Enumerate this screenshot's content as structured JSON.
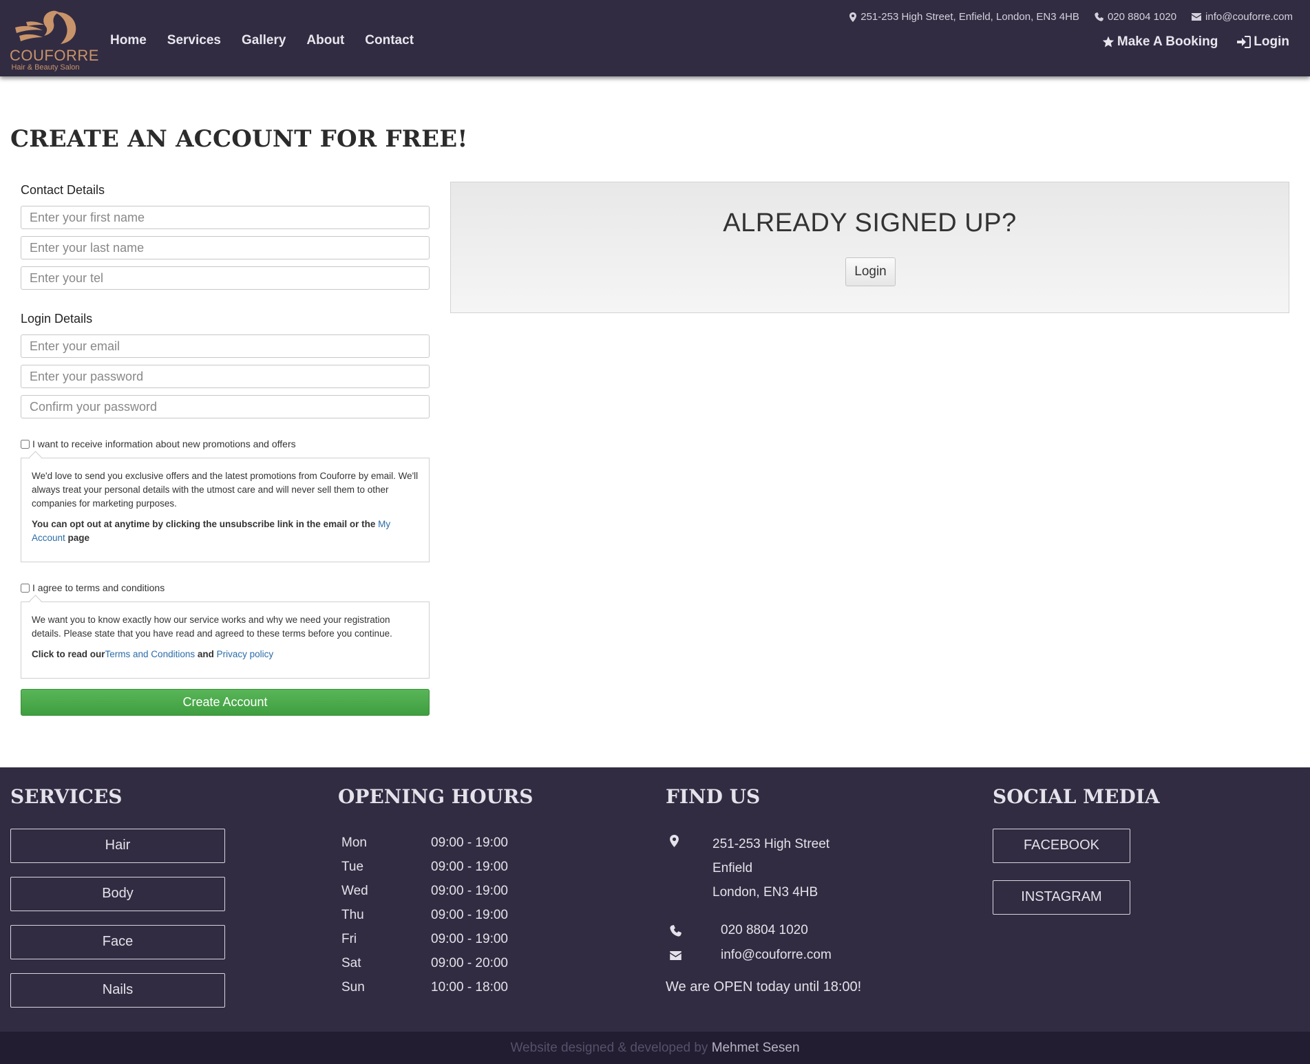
{
  "brand": {
    "name": "COUFORRE",
    "tagline": "Hair & Beauty Salon",
    "accent": "#c9946a"
  },
  "nav": {
    "items": [
      "Home",
      "Services",
      "Gallery",
      "About",
      "Contact"
    ]
  },
  "topbar": {
    "address": "251-253 High Street, Enfield, London, EN3 4HB",
    "phone": "020 8804 1020",
    "email": "info@couforre.com",
    "booking": "Make A Booking",
    "login": "Login"
  },
  "page": {
    "title": "CREATE AN ACCOUNT FOR FREE!"
  },
  "form": {
    "contact_label": "Contact Details",
    "first_name_ph": "Enter your first name",
    "last_name_ph": "Enter your last name",
    "tel_ph": "Enter your tel",
    "login_label": "Login Details",
    "email_ph": "Enter your email",
    "password_ph": "Enter your password",
    "confirm_ph": "Confirm your password",
    "promo_label": "I want to receive information about new promotions and offers",
    "promo_text": "We'd love to send you exclusive offers and the latest promotions from Couforre by email. We'll always treat your personal details with the utmost care and will never sell them to other companies for marketing purposes.",
    "promo_optout": "You can opt out at anytime by clicking the unsubscribe link in the email or the",
    "promo_link": "My Account",
    "promo_page": "page",
    "terms_label": "I agree to terms and conditions",
    "terms_text": "We want you to know exactly how our service works and why we need your registration details. Please state that you have read and agreed to these terms before you continue.",
    "terms_click": "Click to read our",
    "terms_link": "Terms and Conditions",
    "terms_and": "and",
    "privacy_link": "Privacy policy",
    "submit": "Create Account"
  },
  "signedup": {
    "title": "ALREADY SIGNED UP?",
    "button": "Login"
  },
  "footer": {
    "services_title": "SERVICES",
    "services": [
      "Hair",
      "Body",
      "Face",
      "Nails"
    ],
    "hours_title": "OPENING HOURS",
    "hours": [
      {
        "day": "Mon",
        "time": "09:00 - 19:00"
      },
      {
        "day": "Tue",
        "time": "09:00 - 19:00"
      },
      {
        "day": "Wed",
        "time": "09:00 - 19:00"
      },
      {
        "day": "Thu",
        "time": "09:00 - 19:00"
      },
      {
        "day": "Fri",
        "time": "09:00 - 19:00"
      },
      {
        "day": "Sat",
        "time": "09:00 - 20:00"
      },
      {
        "day": "Sun",
        "time": "10:00 - 18:00"
      }
    ],
    "find_title": "FIND US",
    "address_lines": [
      "251-253 High Street",
      "Enfield",
      "London, EN3 4HB"
    ],
    "phone": "020 8804 1020",
    "email": "info@couforre.com",
    "open_status": "We are OPEN today until 18:00!",
    "social_title": "SOCIAL MEDIA",
    "social": [
      "FACEBOOK",
      "INSTAGRAM"
    ],
    "credit_text": "Website designed & developed by",
    "credit_name": "Mehmet Sesen"
  }
}
